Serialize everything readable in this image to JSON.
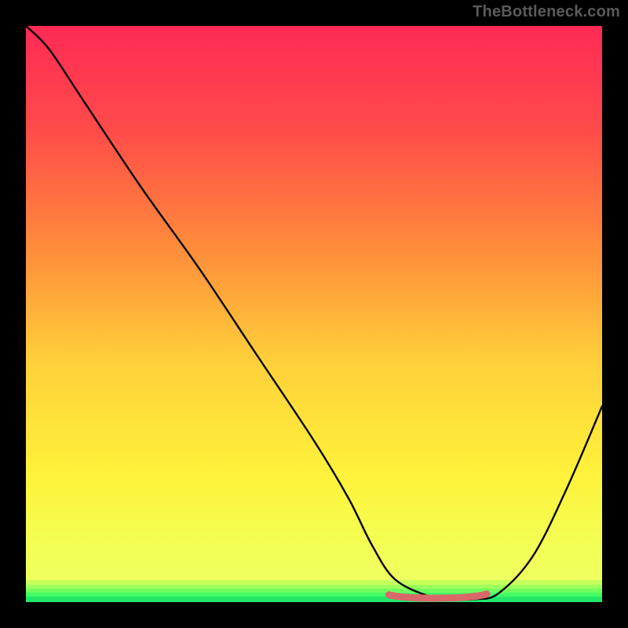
{
  "watermark": "TheBottleneck.com",
  "colors": {
    "frame_bg": "#000000",
    "grad_top": "#ff2a55",
    "grad_mid_upper": "#ff7c3a",
    "grad_mid": "#ffd93a",
    "grad_low": "#f7ff52",
    "grad_bottom_band": "#57ff6e",
    "curve": "#000000",
    "highlight": "#d9686a"
  },
  "chart_data": {
    "type": "line",
    "title": "",
    "xlabel": "",
    "ylabel": "",
    "xlim": [
      0,
      100
    ],
    "ylim": [
      0,
      100
    ],
    "series": [
      {
        "name": "bottleneck-curve",
        "x": [
          0,
          4,
          10,
          20,
          30,
          40,
          50,
          56,
          60,
          64,
          70,
          74,
          78,
          82,
          88,
          94,
          100
        ],
        "y": [
          100,
          96,
          87,
          72,
          58,
          43,
          28,
          18,
          10,
          4,
          1,
          0.5,
          0.5,
          1.5,
          8,
          20,
          34
        ]
      }
    ],
    "highlight_segment": {
      "note": "flat valley band",
      "x": [
        63,
        80
      ],
      "y": [
        1,
        1
      ]
    }
  }
}
